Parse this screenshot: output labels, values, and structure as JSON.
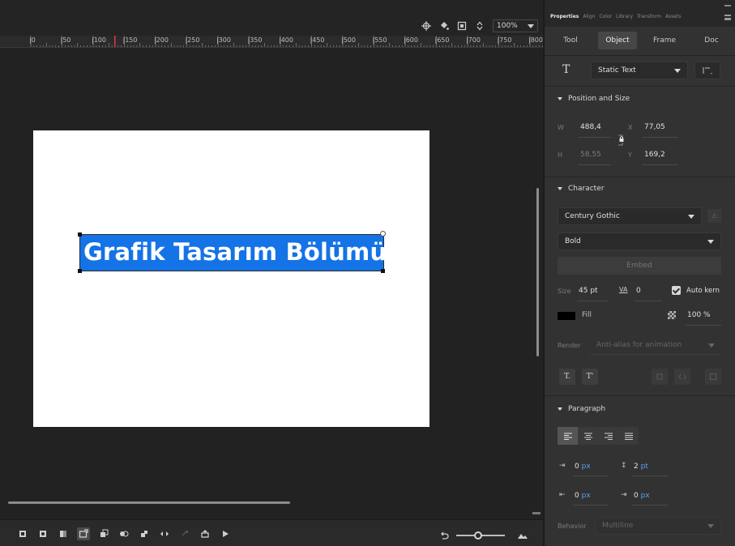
{
  "view_controls": {
    "zoom": "100%"
  },
  "ruler": {
    "labels": [
      "|0",
      "|50",
      "|100",
      "|150",
      "|200",
      "|250",
      "|300",
      "|350",
      "|400",
      "|450",
      "|500",
      "|550",
      "|600",
      "|650",
      "|700",
      "|750",
      "|800"
    ]
  },
  "stage": {
    "selected_text": "Grafik Tasarım Bölümü"
  },
  "panel": {
    "tabs": [
      "Properties",
      "Align",
      "Color",
      "Library",
      "Transform",
      "Assets"
    ],
    "sub_tabs": [
      "Tool",
      "Object",
      "Frame",
      "Doc"
    ],
    "text_type": "Static Text",
    "position_size": {
      "heading": "Position and Size",
      "w_label": "W",
      "w_value": "488,4",
      "h_label": "H",
      "h_value": "58,55",
      "x_label": "X",
      "x_value": "77,05",
      "y_label": "Y",
      "y_value": "169,2"
    },
    "character": {
      "heading": "Character",
      "font_family": "Century Gothic",
      "font_style": "Bold",
      "embed_label": "Embed",
      "size_label": "Size",
      "size_value": "45 pt",
      "tracking_icon": "VA",
      "tracking_value": "0",
      "autokern_label": "Auto kern",
      "autokern_checked": true,
      "fill_label": "Fill",
      "fill_color": "#000000",
      "alpha_value": "100 %",
      "render_label": "Render",
      "render_value": "Anti-alias for animation",
      "subscript_label": "T.",
      "superscript_label": "T'"
    },
    "paragraph": {
      "heading": "Paragraph",
      "indent_value": "0",
      "indent_unit": "px",
      "line_spacing_value": "2",
      "line_spacing_unit": "pt",
      "left_margin_value": "0",
      "left_margin_unit": "px",
      "right_margin_value": "0",
      "right_margin_unit": "px",
      "behavior_label": "Behavior",
      "behavior_value": "Multiline"
    }
  },
  "colors": {
    "selection": "#1473e6",
    "panel_bg": "#323232",
    "stage_bg": "#222222",
    "accent_blue": "#5aa0f0"
  }
}
